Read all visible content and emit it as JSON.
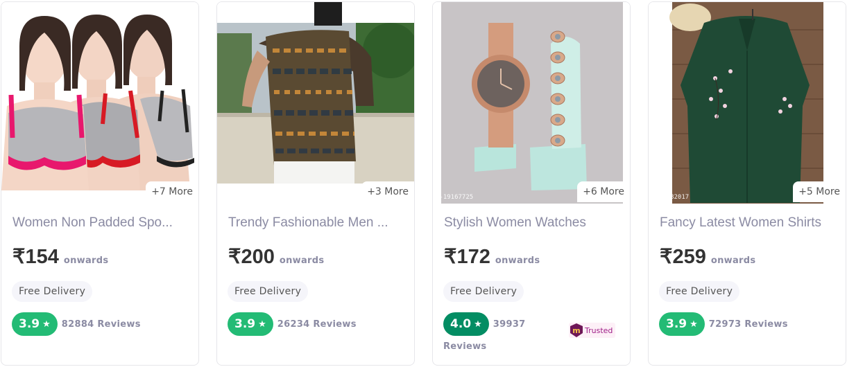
{
  "products": [
    {
      "title": "Women Non Padded Spo...",
      "price": "₹154",
      "onwards": "onwards",
      "more": "+7 More",
      "delivery": "Free Delivery",
      "rating": "3.9",
      "reviews": "82884 Reviews",
      "sku": "s-28275190"
    },
    {
      "title": "Trendy Fashionable Men ...",
      "price": "₹200",
      "onwards": "onwards",
      "more": "+3 More",
      "delivery": "Free Delivery",
      "rating": "3.9",
      "reviews": "26234 Reviews",
      "sku": "s-31463268"
    },
    {
      "title": "Stylish Women Watches",
      "price": "₹172",
      "onwards": "onwards",
      "more": "+6 More",
      "delivery": "Free Delivery",
      "rating": "4.0",
      "reviews_count": "39937",
      "reviews_word": "Reviews",
      "trusted": "Trusted",
      "trusted_logo_letter": "m",
      "sku": "s-19167725"
    },
    {
      "title": "Fancy Latest Women Shirts",
      "price": "₹259",
      "onwards": "onwards",
      "more": "+5 More",
      "delivery": "Free Delivery",
      "rating": "3.9",
      "reviews": "72973 Reviews",
      "sku": "s-42182017"
    }
  ],
  "colors": {
    "rating_green": "#23bb75",
    "rating_dark_green": "#038d63",
    "muted_text": "#8b8ba3",
    "trusted_purple": "#9f2089"
  }
}
